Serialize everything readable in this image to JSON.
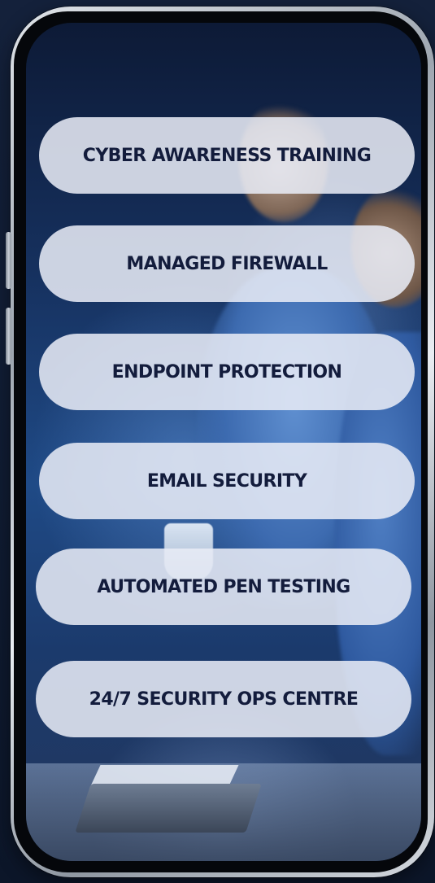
{
  "services": {
    "items": [
      {
        "label": "CYBER AWARENESS TRAINING"
      },
      {
        "label": "MANAGED FIREWALL"
      },
      {
        "label": "ENDPOINT PROTECTION"
      },
      {
        "label": "EMAIL SECURITY"
      },
      {
        "label": "AUTOMATED PEN TESTING"
      },
      {
        "label": "24/7 SECURITY OPS CENTRE"
      }
    ]
  },
  "colors": {
    "page_background": "#13213b",
    "pill_background": "#e8ecf6",
    "pill_text": "#131c3c",
    "screen_blue": "#1f4a86"
  },
  "icons": [
    "phone-frame-mockup"
  ]
}
